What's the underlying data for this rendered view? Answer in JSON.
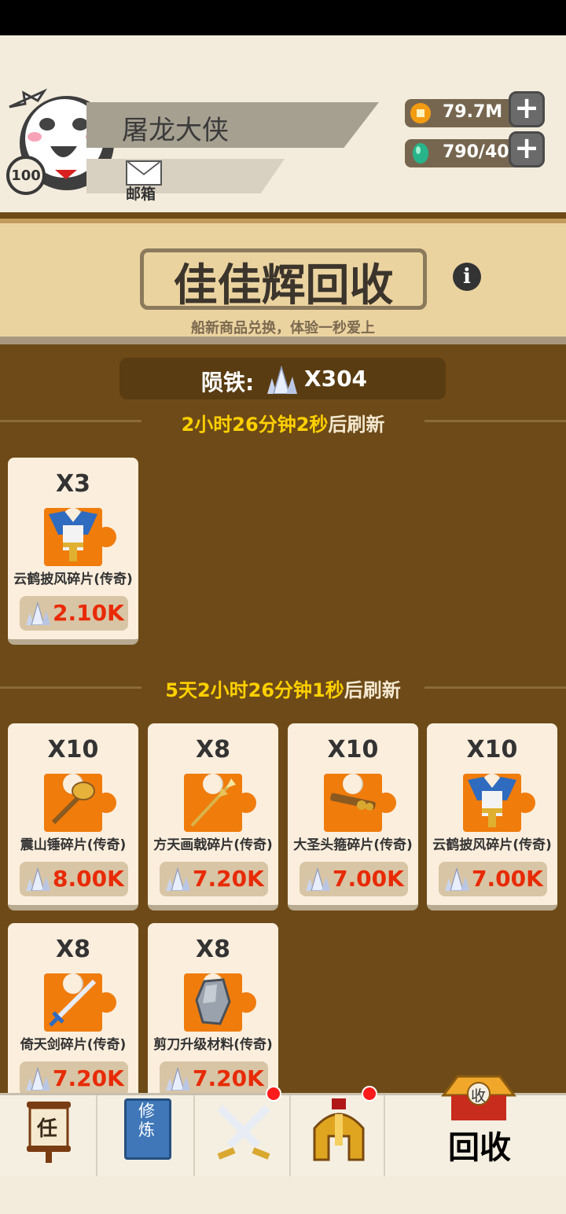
{
  "profile": {
    "name": "屠龙大侠",
    "level": "100",
    "mail_label": "邮箱"
  },
  "resources": [
    {
      "icon": "gold-coin-icon",
      "value": "79.7M",
      "plus": "+"
    },
    {
      "icon": "green-gem-icon",
      "value": "790/40",
      "plus": "+"
    }
  ],
  "shop": {
    "title": "佳佳辉回收",
    "info_glyph": "i",
    "subtitle": "船新商品兑换，体验一秒爱上",
    "currency_label": "陨铁:",
    "currency_value": "X304"
  },
  "sections": [
    {
      "timer_highlight": "2小时26分钟2秒",
      "timer_suffix": "后刷新",
      "items": [
        {
          "qty": "X3",
          "name": "云鹤披风碎片(传奇)",
          "price": "2.10K",
          "icon": "cape-icon"
        }
      ]
    },
    {
      "timer_highlight": "5天2小时26分钟1秒",
      "timer_suffix": "后刷新",
      "items": [
        {
          "qty": "X10",
          "name": "震山锤碎片(传奇)",
          "price": "8.00K",
          "icon": "hammer-icon"
        },
        {
          "qty": "X8",
          "name": "方天画戟碎片(传奇)",
          "price": "7.20K",
          "icon": "halberd-icon"
        },
        {
          "qty": "X10",
          "name": "大圣头箍碎片(传奇)",
          "price": "7.00K",
          "icon": "staff-icon"
        },
        {
          "qty": "X10",
          "name": "云鹤披风碎片(传奇)",
          "price": "7.00K",
          "icon": "cape-icon"
        },
        {
          "qty": "X8",
          "name": "倚天剑碎片(传奇)",
          "price": "7.20K",
          "icon": "sword-icon"
        },
        {
          "qty": "X8",
          "name": "剪刀升级材料(传奇)",
          "price": "7.20K",
          "icon": "stone-icon"
        }
      ]
    }
  ],
  "tabs": [
    {
      "label": "任",
      "icon": "task-scroll-icon"
    },
    {
      "label": "修\n炼",
      "icon": "cultivation-book-icon"
    },
    {
      "label": "",
      "icon": "battle-swords-icon"
    },
    {
      "label": "",
      "icon": "helmet-icon"
    },
    {
      "label": "回收",
      "sign": "收",
      "icon": "recycle-shop-icon"
    }
  ],
  "colors": {
    "panel": "#6d4a17",
    "timer_yellow": "#ffd000",
    "price_red": "#e82a06",
    "item_bg": "#f07c0c"
  }
}
